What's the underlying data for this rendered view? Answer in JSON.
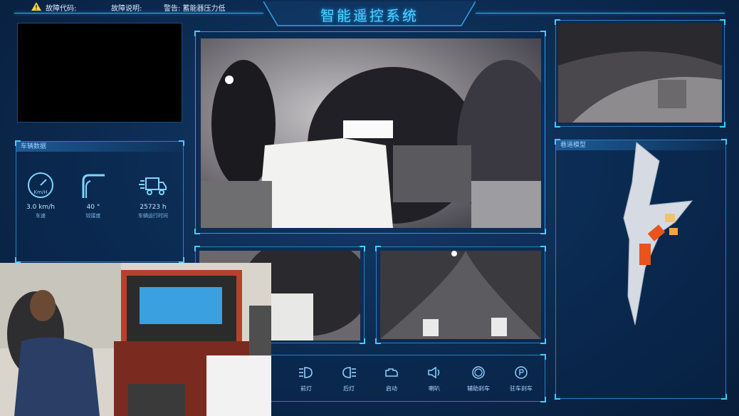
{
  "topbar": {
    "fault_code_label": "故障代码:",
    "fault_desc_label": "故障说明:",
    "warning_text": "警告: 蓄能器压力低"
  },
  "title": "智能遥控系统",
  "vehicle_panel": {
    "header": "车辆数据",
    "stats": [
      {
        "icon": "speedometer-icon",
        "icon_text": "Km/H",
        "value": "3.0 km/h",
        "label": "车速"
      },
      {
        "icon": "articulation-angle-icon",
        "value": "40 °",
        "label": "铰接度"
      },
      {
        "icon": "truck-icon",
        "value": "25723 h",
        "label": "车辆运行时间"
      }
    ]
  },
  "tunnel_panel": {
    "header": "巷道模型"
  },
  "controls": [
    {
      "icon": "headlight-icon",
      "label": "前灯"
    },
    {
      "icon": "rear-light-icon",
      "label": "后灯"
    },
    {
      "icon": "engine-start-icon",
      "label": "启动"
    },
    {
      "icon": "horn-icon",
      "label": "喇叭"
    },
    {
      "icon": "auxiliary-brake-icon",
      "label": "辅助刹车"
    },
    {
      "icon": "parking-brake-icon",
      "label": "驻车刹车"
    }
  ],
  "colors": {
    "accent": "#19b8f0",
    "title": "#4fd3ff",
    "background": "#0b2a52",
    "model_orange": "#e8541c"
  }
}
